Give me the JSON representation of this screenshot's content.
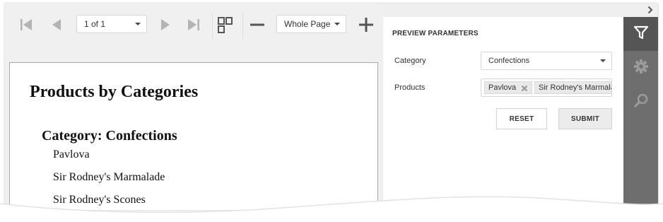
{
  "toolbar": {
    "page_selector": "1 of 1",
    "zoom_selector": "Whole Page"
  },
  "report": {
    "title": "Products by Categories",
    "category_heading": "Category: Confections",
    "products": [
      "Pavlova",
      "Sir Rodney's Marmalade",
      "Sir Rodney's Scones"
    ]
  },
  "panel": {
    "title": "PREVIEW PARAMETERS",
    "category_label": "Category",
    "category_value": "Confections",
    "products_label": "Products",
    "selected_products": [
      "Pavlova",
      "Sir Rodney's Marmalade"
    ],
    "reset_label": "RESET",
    "submit_label": "SUBMIT"
  },
  "sidebar": {
    "tabs": [
      "filter-icon",
      "gear-icon",
      "search-icon"
    ]
  },
  "colors": {
    "sidebar_bg": "#6e6e6e",
    "sidebar_active": "#555555",
    "toolbar_icon": "#b3b3b3"
  }
}
